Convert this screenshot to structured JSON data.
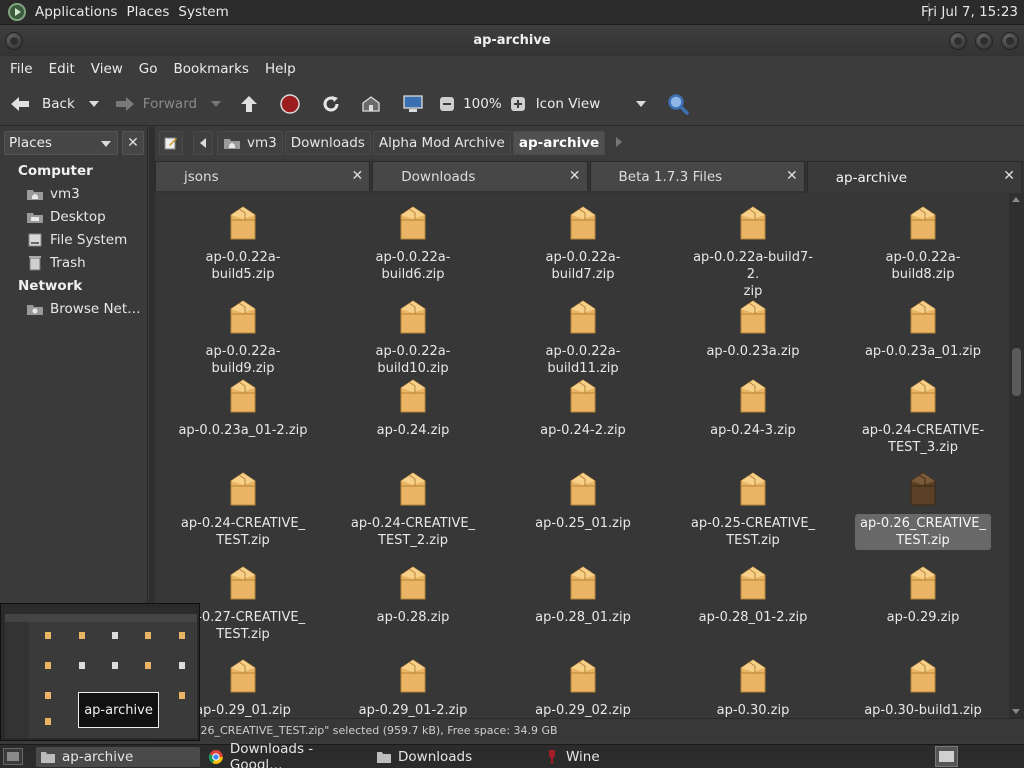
{
  "top_panel": {
    "menus": [
      "Applications",
      "Places",
      "System"
    ],
    "clock": "Fri Jul  7, 15:23"
  },
  "window": {
    "title": "ap-archive"
  },
  "menubar": [
    "File",
    "Edit",
    "View",
    "Go",
    "Bookmarks",
    "Help"
  ],
  "toolbar": {
    "back": "Back",
    "forward": "Forward",
    "zoom": "100%",
    "view_mode": "Icon View"
  },
  "sidepane": {
    "selector": "Places",
    "sections": [
      {
        "title": "Computer",
        "items": [
          {
            "label": "vm3",
            "icon": "home-folder-icon"
          },
          {
            "label": "Desktop",
            "icon": "desktop-folder-icon"
          },
          {
            "label": "File System",
            "icon": "drive-icon"
          },
          {
            "label": "Trash",
            "icon": "trash-icon"
          }
        ]
      },
      {
        "title": "Network",
        "items": [
          {
            "label": "Browse Net…",
            "icon": "network-icon"
          }
        ]
      }
    ]
  },
  "location": {
    "crumbs": [
      "vm3",
      "Downloads",
      "Alpha Mod Archive",
      "ap-archive"
    ],
    "active": "ap-archive"
  },
  "tabs": [
    {
      "label": "jsons",
      "active": false
    },
    {
      "label": "Downloads",
      "active": false
    },
    {
      "label": "Beta 1.7.3 Files",
      "active": false
    },
    {
      "label": "ap-archive",
      "active": true
    }
  ],
  "files": [
    [
      "ap-0.0.22a-build5.zip",
      "ap-0.0.22a-build6.zip",
      "ap-0.0.22a-build7.zip",
      "ap-0.0.22a-build7-2.\nzip",
      "ap-0.0.22a-build8.zip"
    ],
    [
      "ap-0.0.22a-build9.zip",
      "ap-0.0.22a-build10.zip",
      "ap-0.0.22a-build11.zip",
      "ap-0.0.23a.zip",
      "ap-0.0.23a_01.zip"
    ],
    [
      "ap-0.0.23a_01-2.zip",
      "ap-0.24.zip",
      "ap-0.24-2.zip",
      "ap-0.24-3.zip",
      "ap-0.24-CREATIVE-\nTEST_3.zip"
    ],
    [
      "ap-0.24-CREATIVE_\nTEST.zip",
      "ap-0.24-CREATIVE_\nTEST_2.zip",
      "ap-0.25_01.zip",
      "ap-0.25-CREATIVE_\nTEST.zip",
      "ap-0.26_CREATIVE_\nTEST.zip"
    ],
    [
      "ap-0.27-CREATIVE_\nTEST.zip",
      "ap-0.28.zip",
      "ap-0.28_01.zip",
      "ap-0.28_01-2.zip",
      "ap-0.29.zip"
    ],
    [
      "ap-0.29_01.zip",
      "ap-0.29_01-2.zip",
      "ap-0.29_02.zip",
      "ap-0.30.zip",
      "ap-0.30-build1.zip"
    ]
  ],
  "selected_file": "ap-0.26_CREATIVE_\nTEST.zip",
  "statusbar": ".26_CREATIVE_TEST.zip\" selected (959.7 kB), Free space: 34.9 GB",
  "preview_label": "ap-archive",
  "taskbar": [
    {
      "label": "ap-archive",
      "icon": "folder-icon",
      "active": true
    },
    {
      "label": "Downloads - Googl…",
      "icon": "chrome-icon",
      "active": false
    },
    {
      "label": "Downloads",
      "icon": "folder-icon",
      "active": false
    },
    {
      "label": "Wine",
      "icon": "wine-icon",
      "active": false
    }
  ],
  "colors": {
    "folder": "#e9b463",
    "selected_pkg": "#5b4026",
    "panel": "#2b2b2b"
  }
}
